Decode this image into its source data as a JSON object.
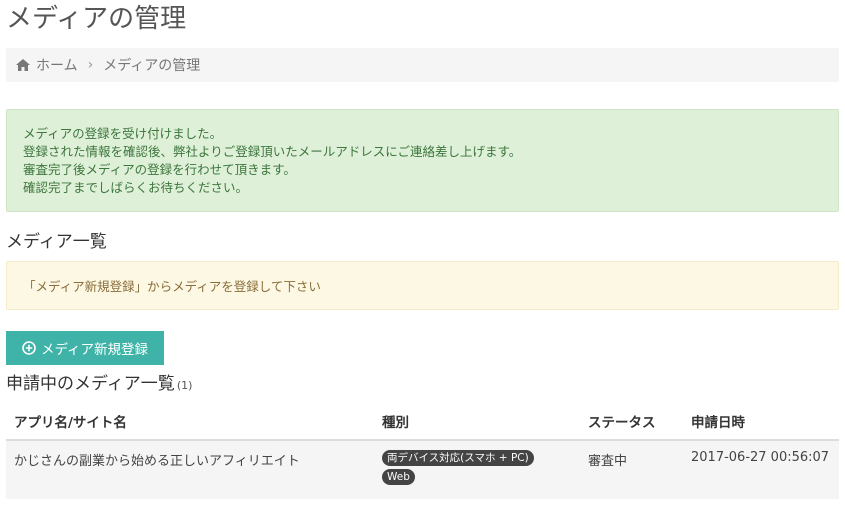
{
  "page": {
    "title": "メディアの管理"
  },
  "breadcrumb": {
    "home": "ホーム",
    "current": "メディアの管理"
  },
  "success_alert": {
    "lines": [
      "メディアの登録を受け付けました。",
      "登録された情報を確認後、弊社よりご登録頂いたメールアドレスにご連絡差し上げます。",
      "審査完了後メディアの登録を行わせて頂きます。",
      "確認完了までしばらくお待ちください。"
    ]
  },
  "media_list": {
    "title": "メディア一覧",
    "notice": "「メディア新規登録」からメディアを登録して下さい"
  },
  "new_button": {
    "label": "メディア新規登録"
  },
  "pending": {
    "title": "申請中のメディア一覧",
    "count": "(1)",
    "headers": [
      "アプリ名/サイト名",
      "種別",
      "ステータス",
      "申請日時"
    ],
    "rows": [
      {
        "name": "かじさんの副業から始める正しいアフィリエイト",
        "types": [
          "両デバイス対応(スマホ + PC)",
          "Web"
        ],
        "status": "審査中",
        "date": "2017-06-27 00:56:07"
      }
    ]
  },
  "colors": {
    "accent": "#3fb3a7",
    "success_bg": "#dff0d8",
    "warning_bg": "#fcf8e3"
  }
}
